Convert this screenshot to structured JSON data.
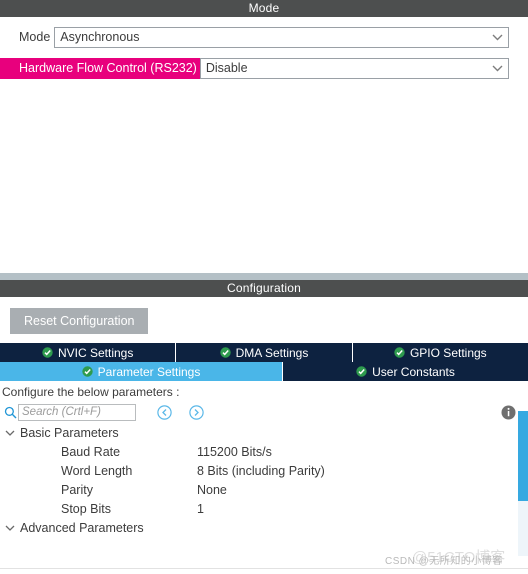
{
  "mode_panel": {
    "header_title": "Mode",
    "rows": [
      {
        "label": "Mode",
        "value": "Asynchronous",
        "highlighted": false,
        "icon": "chevron-down-icon"
      },
      {
        "label": "Hardware Flow Control (RS232)",
        "value": "Disable",
        "highlighted": true,
        "icon": "chevron-down-icon"
      }
    ],
    "highlight_color": "#e8007d"
  },
  "configuration_panel": {
    "header_title": "Configuration",
    "reset_button_label": "Reset Configuration",
    "tabs_row1": [
      {
        "label": "NVIC Settings",
        "icon": "check-circle-icon",
        "active": false
      },
      {
        "label": "DMA Settings",
        "icon": "check-circle-icon",
        "active": false
      },
      {
        "label": "GPIO Settings",
        "icon": "check-circle-icon",
        "active": false
      }
    ],
    "tabs_row2": [
      {
        "label": "Parameter Settings",
        "icon": "check-circle-icon",
        "active": true
      },
      {
        "label": "User Constants",
        "icon": "check-circle-icon",
        "active": false
      }
    ],
    "tab_active_color": "#4ab6e8",
    "tab_inactive_color": "#0d2240"
  },
  "parameters": {
    "configure_note": "Configure the below parameters :",
    "search_placeholder": "Search (Crtl+F)",
    "search_value": "",
    "search_icon": "magnifier-icon",
    "nav_back_icon": "circle-left-arrow-icon",
    "nav_forward_icon": "circle-right-arrow-icon",
    "info_icon": "info-icon",
    "groups": [
      {
        "title": "Basic Parameters",
        "expanded": true,
        "rows": [
          {
            "name": "Baud Rate",
            "value": "115200 Bits/s"
          },
          {
            "name": "Word Length",
            "value": "8 Bits (including Parity)"
          },
          {
            "name": "Parity",
            "value": "None"
          },
          {
            "name": "Stop Bits",
            "value": "1"
          }
        ]
      },
      {
        "title": "Advanced Parameters",
        "expanded": true,
        "rows": []
      }
    ],
    "scrollbar_color": "#36a9e1"
  },
  "watermarks": {
    "csdn": "CSDN @无所知的小博客",
    "cto": "@51CTO博客"
  }
}
